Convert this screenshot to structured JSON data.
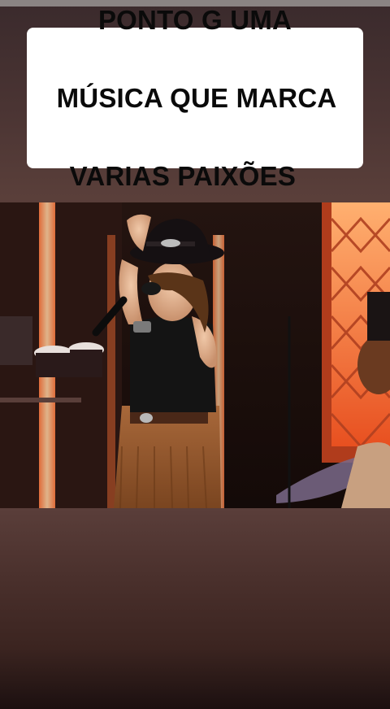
{
  "caption": {
    "line1": "PONTO G UMA",
    "line2": "MÚSICA QUE MARCA",
    "line3": "VARIAS PAIXÕES"
  },
  "video": {
    "description_icon": "performer-video-frame"
  },
  "colors": {
    "caption_bg": "#ffffff",
    "caption_text": "#0a0a0a",
    "background": "#3c2622"
  }
}
